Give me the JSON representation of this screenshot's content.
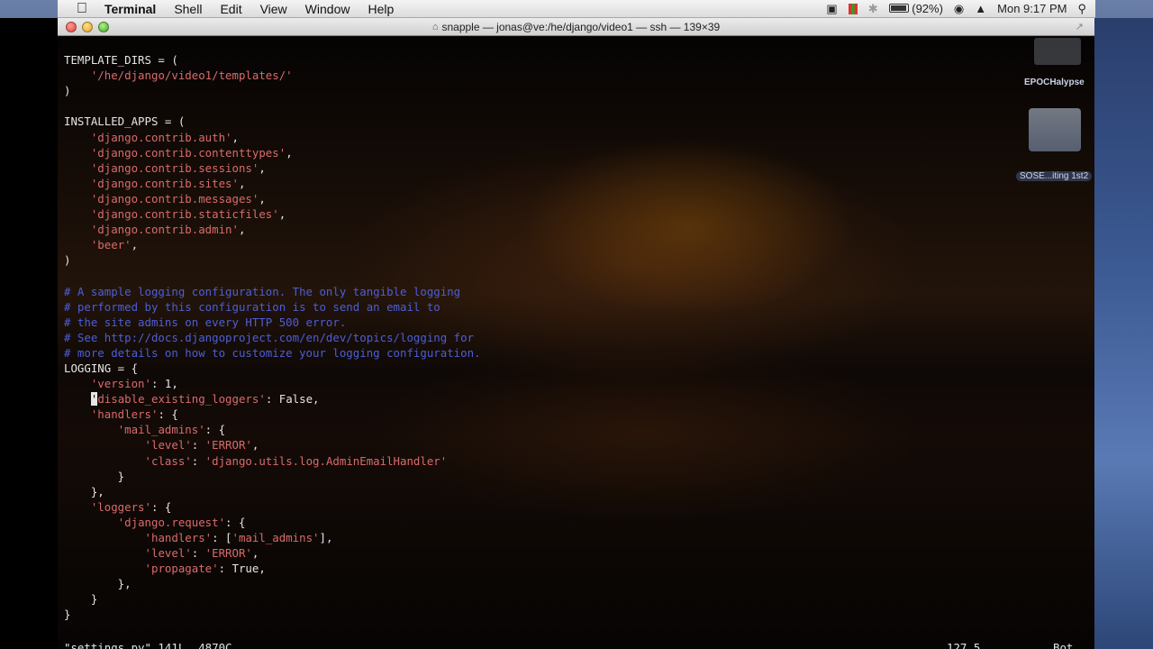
{
  "menubar": {
    "apple": "",
    "items": [
      "Terminal",
      "Shell",
      "Edit",
      "View",
      "Window",
      "Help"
    ],
    "battery": "(92%)",
    "clock": "Mon 9:17 PM"
  },
  "window": {
    "title": "snapple — jonas@ve:/he/django/video1 — ssh — 139×39"
  },
  "desktop": {
    "label_1": "EPOCHalypse",
    "label_2": "SOSE...iting  1st2"
  },
  "editor": {
    "lines": [
      "",
      "TEMPLATE_DIRS = (",
      "    '/he/django/video1/templates/'",
      ")",
      "",
      "INSTALLED_APPS = (",
      "    'django.contrib.auth',",
      "    'django.contrib.contenttypes',",
      "    'django.contrib.sessions',",
      "    'django.contrib.sites',",
      "    'django.contrib.messages',",
      "    'django.contrib.staticfiles',",
      "    'django.contrib.admin',",
      "    'beer',",
      ")",
      "",
      "# A sample logging configuration. The only tangible logging",
      "# performed by this configuration is to send an email to",
      "# the site admins on every HTTP 500 error.",
      "# See http://docs.djangoproject.com/en/dev/topics/logging for",
      "# more details on how to customize your logging configuration.",
      "LOGGING = {",
      "    'version': 1,",
      "    'disable_existing_loggers': False,",
      "    'handlers': {",
      "        'mail_admins': {",
      "            'level': 'ERROR',",
      "            'class': 'django.utils.log.AdminEmailHandler'",
      "        }",
      "    },",
      "    'loggers': {",
      "        'django.request': {",
      "            'handlers': ['mail_admins'],",
      "            'level': 'ERROR',",
      "            'propagate': True,",
      "        },",
      "    }",
      "}"
    ],
    "status_file": "\"settings.py\" 141L, 4870C",
    "status_pos": "127,5",
    "status_where": "Bot"
  },
  "colors": {
    "string": "#d96b6b",
    "comment": "#4d5ed6",
    "text": "#e6e6e6"
  }
}
